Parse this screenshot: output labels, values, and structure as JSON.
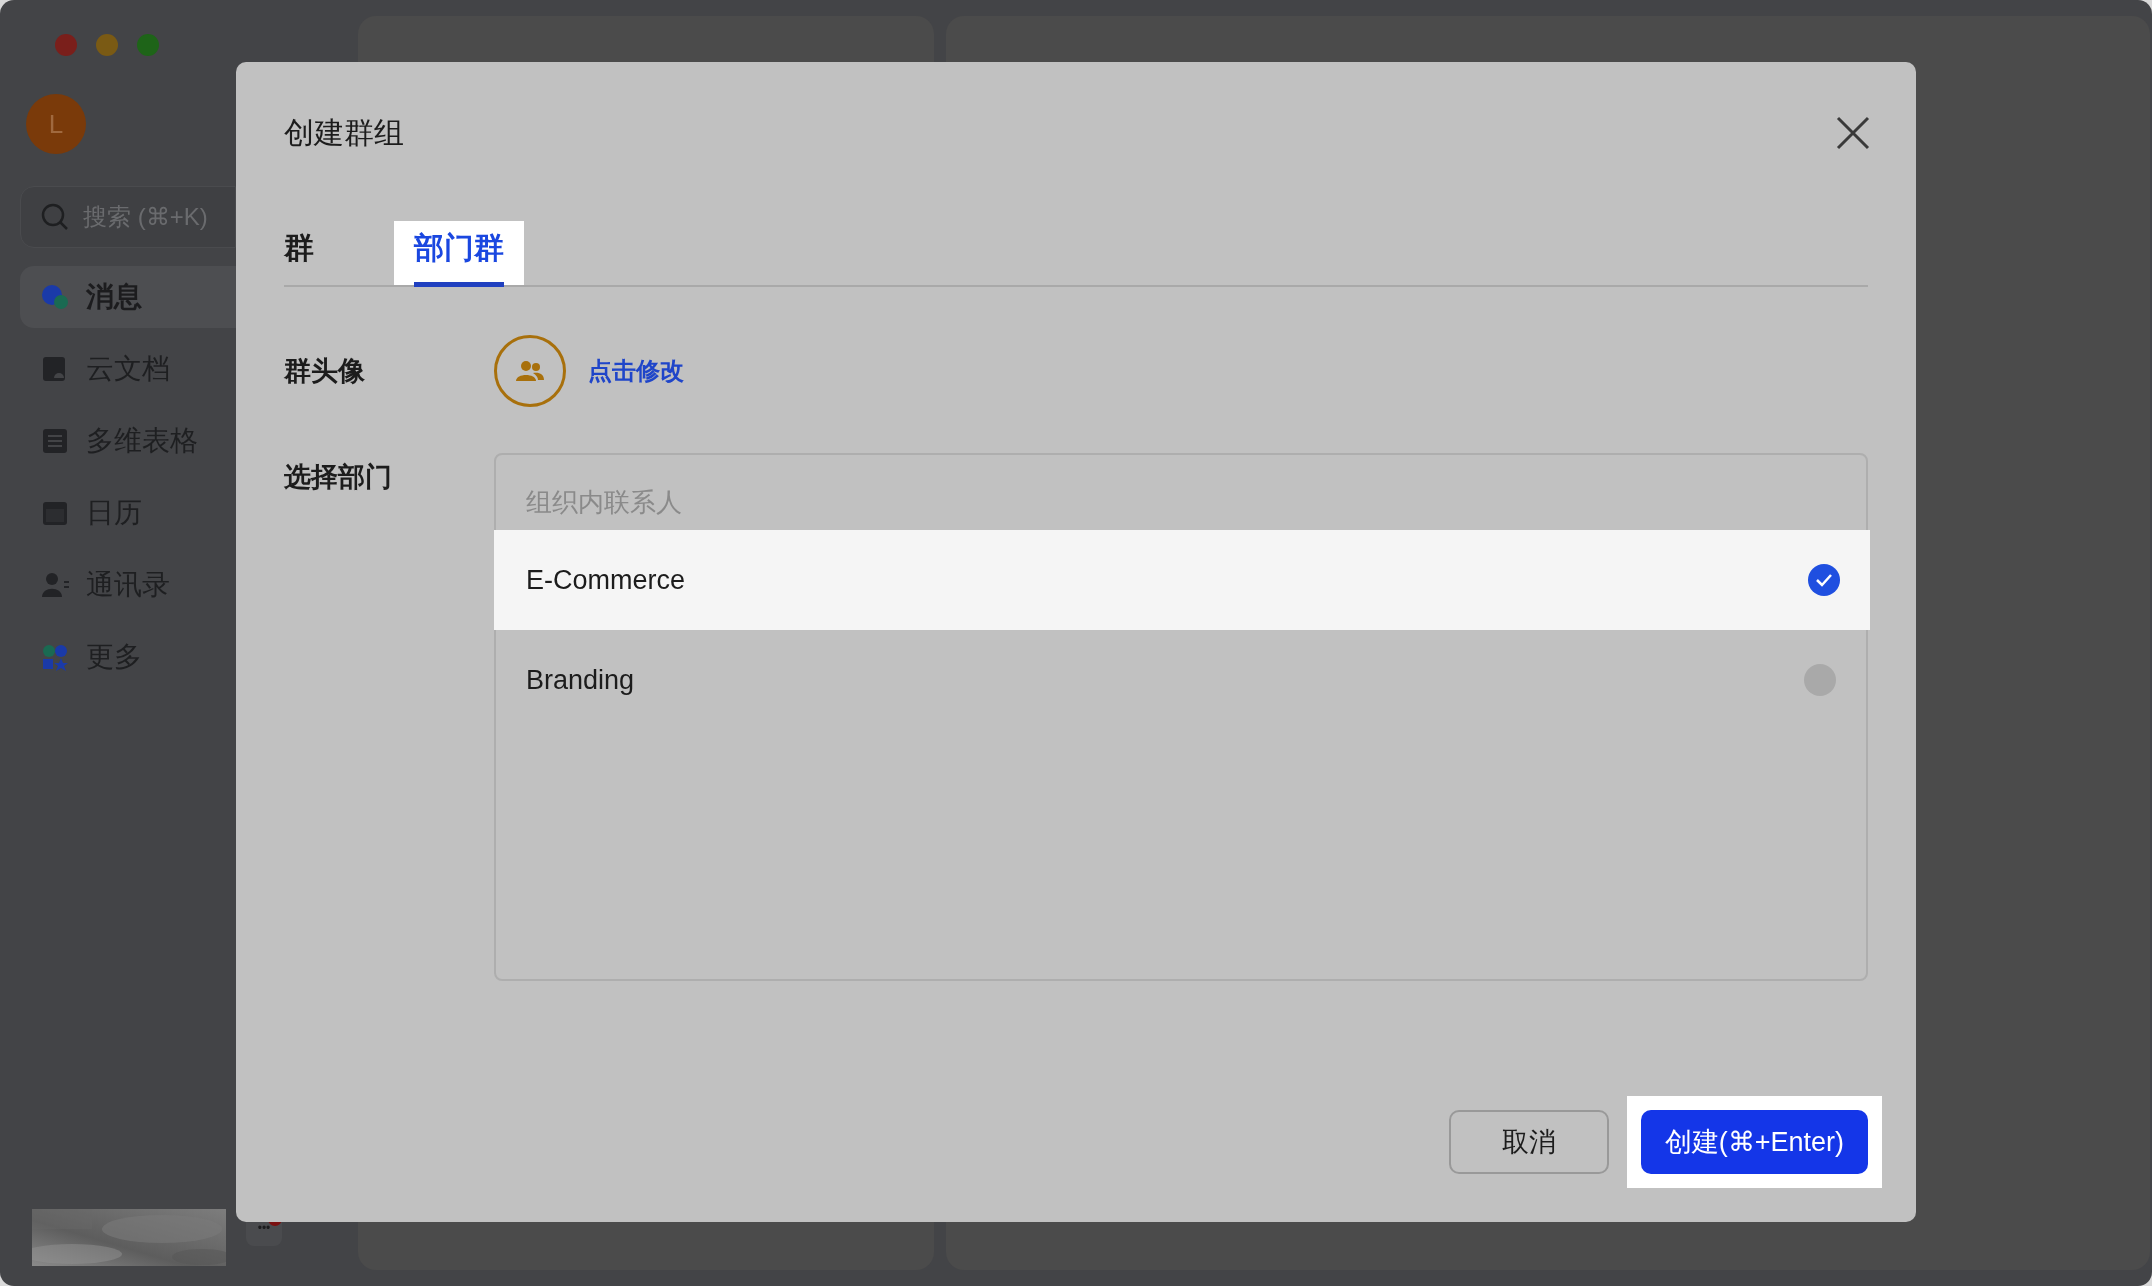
{
  "sidebar": {
    "avatar_initial": "L",
    "search": {
      "placeholder": "搜索 (⌘+K)"
    },
    "items": [
      {
        "label": "消息",
        "kind": "chat",
        "selected": true
      },
      {
        "label": "云文档",
        "kind": "docs",
        "selected": false
      },
      {
        "label": "多维表格",
        "kind": "table",
        "selected": false
      },
      {
        "label": "日历",
        "kind": "calendar",
        "selected": false
      },
      {
        "label": "通讯录",
        "kind": "contacts",
        "selected": false
      },
      {
        "label": "更多",
        "kind": "more",
        "selected": false
      }
    ],
    "more_button": "•••"
  },
  "dialog": {
    "title": "创建群组",
    "tabs": [
      {
        "label": "群",
        "selected": false,
        "highlighted": false
      },
      {
        "label": "部门群",
        "selected": true,
        "highlighted": true
      }
    ],
    "avatar_label": "群头像",
    "avatar_link": "点击修改",
    "department_label": "选择部门",
    "list_header": "组织内联系人",
    "departments": [
      {
        "name": "E-Commerce",
        "selected": true,
        "highlighted": true
      },
      {
        "name": "Branding",
        "selected": false,
        "highlighted": false
      }
    ],
    "buttons": [
      {
        "label": "取消",
        "kind": "secondary",
        "highlighted": false
      },
      {
        "label": "创建(⌘+Enter)",
        "kind": "primary",
        "highlighted": true
      }
    ]
  }
}
